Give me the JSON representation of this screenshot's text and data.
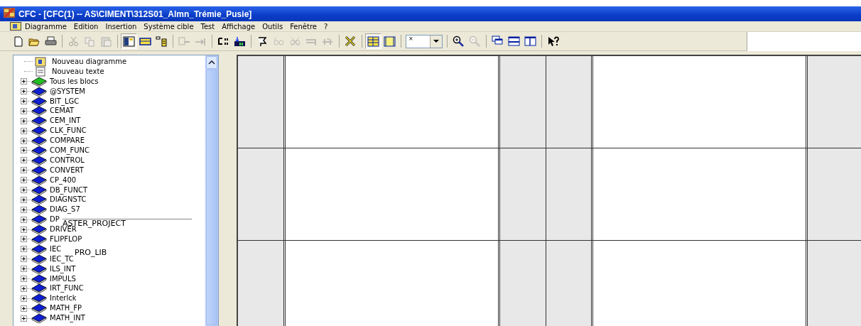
{
  "window": {
    "title": "CFC - [CFC(1) -- AS\\CIMENT\\312S01_Almn_Trémie_Pusie]"
  },
  "menu": [
    "Diagramme",
    "Edition",
    "Insertion",
    "Système cible",
    "Test",
    "Affichage",
    "Outils",
    "Fenêtre",
    "?"
  ],
  "toolbar": [
    [
      {
        "kind": "new",
        "disabled": false,
        "pressed": false
      },
      {
        "kind": "open",
        "disabled": false,
        "pressed": false
      },
      {
        "kind": "print",
        "disabled": false,
        "pressed": false
      }
    ],
    [
      {
        "kind": "cut",
        "disabled": true,
        "pressed": false
      },
      {
        "kind": "copy",
        "disabled": true,
        "pressed": false
      },
      {
        "kind": "paste",
        "disabled": true,
        "pressed": false
      }
    ],
    [
      {
        "kind": "catalog",
        "disabled": false,
        "pressed": true
      },
      {
        "kind": "bar",
        "disabled": false,
        "pressed": false
      },
      {
        "kind": "tree",
        "disabled": false,
        "pressed": false
      }
    ],
    [
      {
        "kind": "link",
        "disabled": true,
        "pressed": false
      },
      {
        "kind": "arrow",
        "disabled": true,
        "pressed": false
      }
    ],
    [
      {
        "kind": "compile",
        "disabled": false,
        "pressed": false
      },
      {
        "kind": "download",
        "disabled": false,
        "pressed": false
      }
    ],
    [
      {
        "kind": "flag",
        "disabled": false,
        "pressed": false
      },
      {
        "kind": "glasses",
        "disabled": true,
        "pressed": false
      },
      {
        "kind": "crossglasses",
        "disabled": true,
        "pressed": false
      },
      {
        "kind": "lines",
        "disabled": true,
        "pressed": false
      },
      {
        "kind": "connect",
        "disabled": true,
        "pressed": false
      }
    ],
    [
      {
        "kind": "expand",
        "disabled": false,
        "pressed": false
      }
    ],
    [
      {
        "kind": "grid",
        "disabled": false,
        "pressed": true
      },
      {
        "kind": "sheet",
        "disabled": false,
        "pressed": false
      }
    ],
    [
      {
        "kind": "combo",
        "value": "×"
      }
    ],
    [
      {
        "kind": "zoomin",
        "disabled": false,
        "pressed": false
      },
      {
        "kind": "zoomout",
        "disabled": true,
        "pressed": false
      }
    ],
    [
      {
        "kind": "cascade",
        "disabled": false,
        "pressed": false
      },
      {
        "kind": "tileh",
        "disabled": false,
        "pressed": false
      },
      {
        "kind": "tilev",
        "disabled": false,
        "pressed": false
      }
    ],
    [
      {
        "kind": "help",
        "disabled": false,
        "pressed": false
      }
    ]
  ],
  "tree": [
    {
      "kind": "diagram",
      "label": "Nouveau diagramme"
    },
    {
      "kind": "text",
      "label": "Nouveau texte"
    },
    {
      "kind": "library",
      "label": "Tous les blocs",
      "color": "#22c022",
      "expanded": false
    },
    {
      "kind": "library",
      "label": "@SYSTEM",
      "color": "#1020d0",
      "expanded": false
    },
    {
      "kind": "library",
      "label": "BIT_LGC",
      "color": "#1020d0",
      "expanded": false
    },
    {
      "kind": "library",
      "label": "CEMAT",
      "color": "#1020d0",
      "expanded": false
    },
    {
      "kind": "library",
      "label": "CEM_INT",
      "color": "#1020d0",
      "expanded": false
    },
    {
      "kind": "library",
      "label": "CLK_FUNC",
      "color": "#1020d0",
      "expanded": false
    },
    {
      "kind": "library",
      "label": "COMPARE",
      "color": "#1020d0",
      "expanded": false
    },
    {
      "kind": "library",
      "label": "COM_FUNC",
      "color": "#1020d0",
      "expanded": false
    },
    {
      "kind": "library",
      "label": "CONTROL",
      "color": "#1020d0",
      "expanded": false
    },
    {
      "kind": "library",
      "label": "CONVERT",
      "color": "#1020d0",
      "expanded": false
    },
    {
      "kind": "library",
      "label": "CP_400",
      "color": "#1020d0",
      "expanded": false
    },
    {
      "kind": "library",
      "label": "DB_FUNCT",
      "color": "#1020d0",
      "expanded": false
    },
    {
      "kind": "library",
      "label": "DIAGNSTC",
      "color": "#1020d0",
      "expanded": false
    },
    {
      "kind": "library",
      "label": "DIAG_S7",
      "color": "#1020d0",
      "expanded": false
    },
    {
      "kind": "library",
      "label": "DP",
      "color": "#1020d0",
      "expanded": false
    },
    {
      "kind": "library",
      "label": "DRIVER",
      "color": "#1020d0",
      "expanded": false
    },
    {
      "kind": "library",
      "label": "FLIPFLOP",
      "color": "#1020d0",
      "expanded": false
    },
    {
      "kind": "library",
      "label": "IEC",
      "color": "#1020d0",
      "expanded": false
    },
    {
      "kind": "library",
      "label": "IEC_TC",
      "color": "#1020d0",
      "expanded": false
    },
    {
      "kind": "library",
      "label": "ILS_INT",
      "color": "#1020d0",
      "expanded": false
    },
    {
      "kind": "library",
      "label": "IMPULS",
      "color": "#1020d0",
      "expanded": false
    },
    {
      "kind": "library",
      "label": "IRT_FUNC",
      "color": "#1020d0",
      "expanded": false
    },
    {
      "kind": "library",
      "label": "Interlck",
      "color": "#1020d0",
      "expanded": false
    },
    {
      "kind": "library",
      "label": "MATH_FP",
      "color": "#1020d0",
      "expanded": false
    },
    {
      "kind": "library",
      "label": "MATH_INT",
      "color": "#1020d0",
      "expanded": false
    }
  ],
  "tooltip": {
    "text": "ASTER_PROJECT",
    "ghost_text": "PRO_LIB"
  }
}
